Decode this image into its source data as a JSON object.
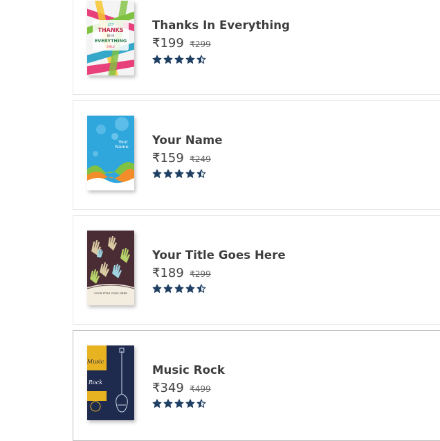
{
  "colors": {
    "star": "#1f3f63",
    "title": "#3d3d3d",
    "price": "#444444",
    "border": "#e6e6e6"
  },
  "products": [
    {
      "title": "Thanks In Everything",
      "price": "₹199",
      "mrp": "₹299",
      "rating": 4.5,
      "cover_text": [
        "LET",
        "THANKS",
        "BE IN",
        "EVERYTHING",
        "SMILE"
      ]
    },
    {
      "title": "Your Name",
      "price": "₹159",
      "mrp": "₹249",
      "rating": 4.5,
      "cover_text": [
        "Your",
        "Name"
      ]
    },
    {
      "title": "Your Title Goes Here",
      "price": "₹189",
      "mrp": "₹299",
      "rating": 4.5,
      "cover_text": [
        "YOUR TITLE GOES HERE"
      ]
    },
    {
      "title": "Music Rock",
      "price": "₹349",
      "mrp": "₹499",
      "rating": 4.5,
      "cover_text": [
        "Music",
        "Rock"
      ]
    }
  ]
}
